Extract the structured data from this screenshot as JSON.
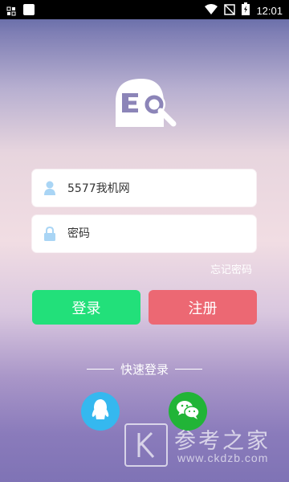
{
  "status_bar": {
    "time": "12:01"
  },
  "login": {
    "username_value": "5577我机网",
    "password_placeholder": "密码",
    "forgot_password": "忘记密码",
    "login_button": "登录",
    "register_button": "注册"
  },
  "quick_login": {
    "title": "快速登录",
    "providers": [
      "qq-icon",
      "wechat-icon"
    ]
  },
  "watermark": {
    "chinese": "参考之家",
    "url": "www.ckdzb.com"
  },
  "colors": {
    "login_button": "#22e07a",
    "register_button": "#ec6873",
    "qq": "#35b8ef",
    "wechat": "#21b437"
  }
}
